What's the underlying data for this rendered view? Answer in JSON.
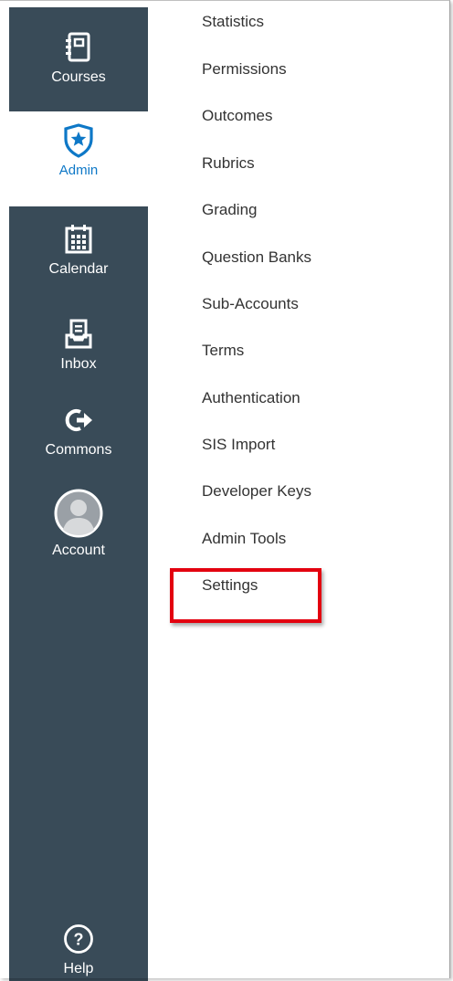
{
  "global_nav": {
    "background": "#394b58",
    "accent": "#0e78c7",
    "items": [
      {
        "label": "Courses",
        "icon": "courses-icon"
      },
      {
        "label": "Admin",
        "icon": "admin-shield-star-icon",
        "active": true
      },
      {
        "label": "Calendar",
        "icon": "calendar-icon"
      },
      {
        "label": "Inbox",
        "icon": "inbox-icon"
      },
      {
        "label": "Commons",
        "icon": "commons-icon"
      },
      {
        "label": "Account",
        "icon": "account-avatar-icon"
      }
    ],
    "help": {
      "label": "Help",
      "icon": "help-icon"
    }
  },
  "admin_menu": {
    "items": [
      "Statistics",
      "Permissions",
      "Outcomes",
      "Rubrics",
      "Grading",
      "Question Banks",
      "Sub-Accounts",
      "Terms",
      "Authentication",
      "SIS Import",
      "Developer Keys",
      "Admin Tools",
      "Settings"
    ],
    "highlighted_item": "Settings",
    "highlight_color": "#e3000f"
  }
}
